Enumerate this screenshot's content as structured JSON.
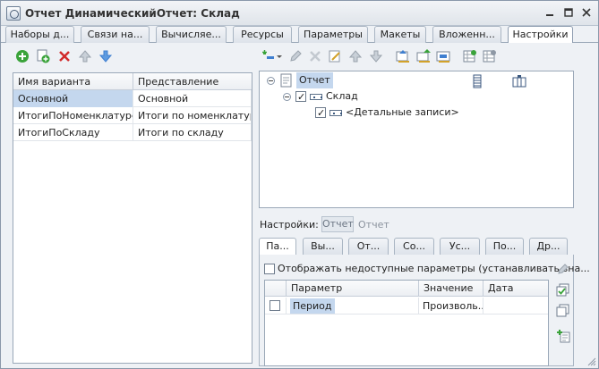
{
  "window": {
    "title": "Отчет ДинамическийОтчет: Склад"
  },
  "main_tabs": [
    {
      "label": "Наборы д..."
    },
    {
      "label": "Связи на..."
    },
    {
      "label": "Вычисляе..."
    },
    {
      "label": "Ресурсы"
    },
    {
      "label": "Параметры"
    },
    {
      "label": "Макеты"
    },
    {
      "label": "Вложенн..."
    },
    {
      "label": "Настройки"
    }
  ],
  "variants": {
    "columns": [
      "Имя варианта",
      "Представление"
    ],
    "rows": [
      {
        "name": "Основной",
        "presentation": "Основной"
      },
      {
        "name": "ИтогиПоНоменклатуре",
        "presentation": "Итоги по номенклатуре"
      },
      {
        "name": "ИтогиПоСкладу",
        "presentation": "Итоги по складу"
      }
    ]
  },
  "structure": {
    "root": "Отчет",
    "group": "Склад",
    "detail": "<Детальные записи>"
  },
  "settings": {
    "label": "Настройки:",
    "badge": "Отчет",
    "value": "Отчет"
  },
  "sub_tabs": [
    {
      "label": "Па..."
    },
    {
      "label": "Вы..."
    },
    {
      "label": "От..."
    },
    {
      "label": "Со..."
    },
    {
      "label": "Ус..."
    },
    {
      "label": "По..."
    },
    {
      "label": "Др..."
    }
  ],
  "params": {
    "show_unavailable_label": "Отображать недоступные параметры (устанавливать зна...",
    "columns": [
      "Параметр",
      "Значение",
      "Дата"
    ],
    "rows": [
      {
        "param": "Период",
        "value": "Произволь...",
        "date": ""
      }
    ]
  },
  "colors": {
    "selection": "#c4d7ee",
    "accent_green": "#3aa33a",
    "accent_red": "#d12a2a",
    "accent_blue": "#3f7fd0"
  }
}
